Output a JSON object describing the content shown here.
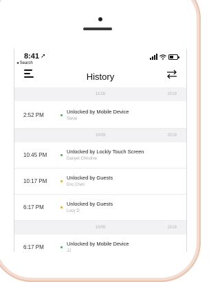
{
  "status_bar": {
    "time": "8:41",
    "back_label": "◂ Search"
  },
  "nav": {
    "title": "History"
  },
  "colors": {
    "mobile_dot": "#4caf50",
    "guest_dot": "#f5a623",
    "touch_dot": "#4caf50"
  },
  "sections": [
    {
      "date": "11/16",
      "year": "2018",
      "rows": [
        {
          "time": "2:52 PM",
          "event": "Unlocked by Mobile Device",
          "user": "Steve",
          "dot": "#4caf50"
        }
      ]
    },
    {
      "date": "10/08",
      "year": "2018",
      "rows": [
        {
          "time": "10:45 PM",
          "event": "Unlocked by Lockly Touch Screen",
          "user": "Danyel Christine",
          "dot": "#4caf50"
        },
        {
          "time": "10:17 PM",
          "event": "Unlocked by Guests",
          "user": "Eric Chen",
          "dot": "#f5a623"
        },
        {
          "time": "6:17 PM",
          "event": "Unlocked by Guests",
          "user": "Lucy D",
          "dot": "#f5a623"
        }
      ]
    },
    {
      "date": "10/06",
      "year": "2018",
      "rows": [
        {
          "time": "6:17 PM",
          "event": "Unlocked by Mobile Device",
          "user": "JJ",
          "dot": "#4caf50"
        }
      ]
    }
  ]
}
